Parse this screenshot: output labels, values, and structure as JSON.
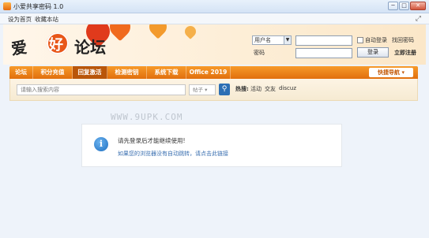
{
  "window": {
    "title": "小爱共享密码 1.0",
    "controls": [
      "─",
      "□",
      "✕"
    ]
  },
  "menubar": {
    "items": [
      "设为首页",
      "收藏本站"
    ]
  },
  "logo": {
    "part1": "爱",
    "part2": "好",
    "part3": "论坛"
  },
  "login": {
    "username_select": "用户名",
    "password_label": "密码",
    "remember_label": "自动登录",
    "forgot_link": "找回密码",
    "login_button": "登录",
    "register_link": "立即注册"
  },
  "nav": {
    "items": [
      "论坛",
      "积分充值",
      "回复激活",
      "检测密钥",
      "系统下载",
      "Office 2019"
    ],
    "active_index": 2,
    "quick_nav": "快捷导航"
  },
  "search": {
    "placeholder": "请输入搜索内容",
    "scope": "帖子",
    "hot_label": "热搜:",
    "hot_links": [
      "活动",
      "交友",
      "discuz"
    ]
  },
  "watermark": "WWW.9UPK.COM",
  "message": {
    "main": "请先登录后才能继续使用!",
    "sub": "如果您的浏览器没有自动跳转，请点击此链接"
  },
  "colors": {
    "accent_orange": "#f0841c",
    "link_blue": "#3a6fb0",
    "search_button": "#2d6fb4"
  }
}
